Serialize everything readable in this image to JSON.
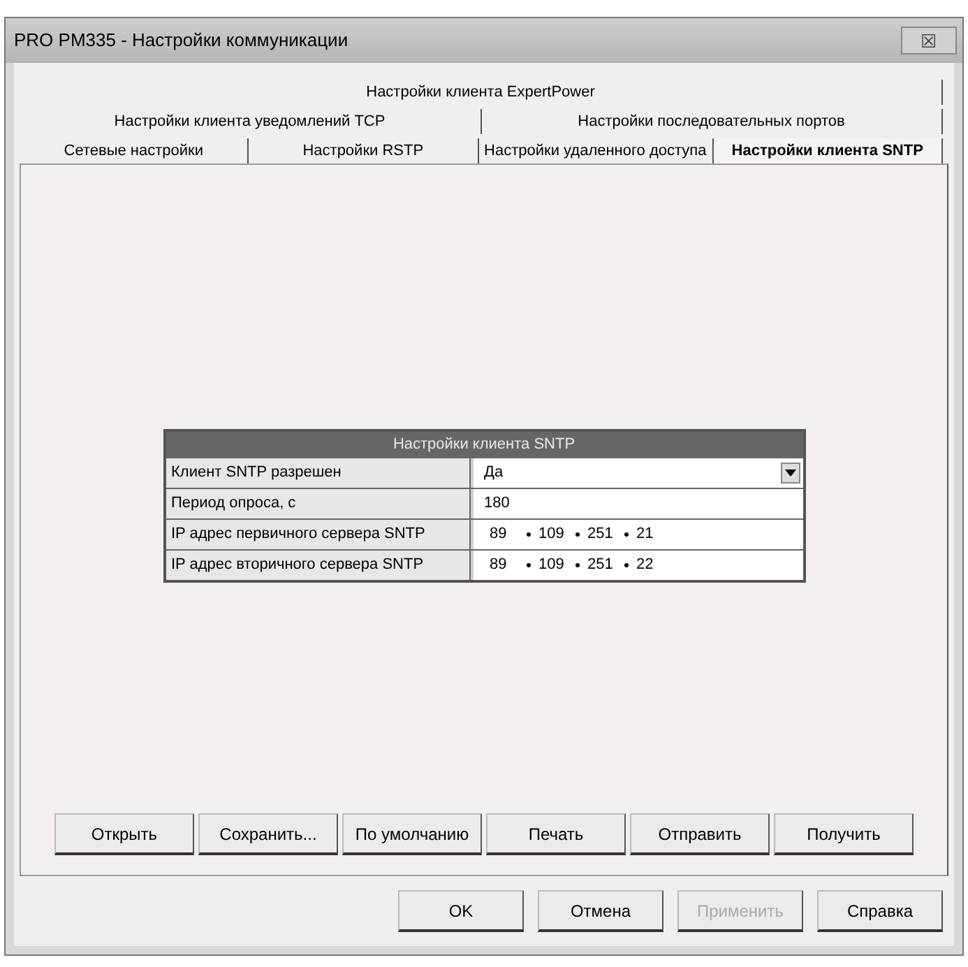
{
  "window": {
    "title": "PRO PM335 - Настройки коммуникации",
    "close": "☒"
  },
  "tab_rows": [
    [
      {
        "label": "Настройки клиента ExpertPower",
        "selected": false
      }
    ],
    [
      {
        "label": "Настройки клиента уведомлений TCP",
        "selected": false
      },
      {
        "label": "Настройки последовательных портов",
        "selected": false
      }
    ],
    [
      {
        "label": "Сетевые настройки",
        "selected": false
      },
      {
        "label": "Настройки RSTP",
        "selected": false
      },
      {
        "label": "Настройки удаленного доступа",
        "selected": false
      },
      {
        "label": "Настройки клиента SNTP",
        "selected": true
      }
    ]
  ],
  "settings_table": {
    "title": "Настройки клиента SNTP",
    "rows": [
      {
        "kind": "dropdown",
        "label": "Клиент SNTP разрешен",
        "value": "Да"
      },
      {
        "kind": "text",
        "label": "Период опроса, с",
        "value": "180"
      },
      {
        "kind": "ip",
        "label": "IP адрес первичного сервера SNTP",
        "octets": [
          "89",
          "109",
          "251",
          "21"
        ]
      },
      {
        "kind": "ip",
        "label": "IP адрес вторичного сервера SNTP",
        "octets": [
          "89",
          "109",
          "251",
          "22"
        ]
      }
    ]
  },
  "panel_buttons": [
    {
      "label": "Открыть"
    },
    {
      "label": "Сохранить..."
    },
    {
      "label": "По умолчанию"
    },
    {
      "label": "Печать"
    },
    {
      "label": "Отправить"
    },
    {
      "label": "Получить"
    }
  ],
  "dialog_buttons": [
    {
      "label": "OK",
      "disabled": false
    },
    {
      "label": "Отмена",
      "disabled": false
    },
    {
      "label": "Применить",
      "disabled": true
    },
    {
      "label": "Справка",
      "disabled": false
    }
  ]
}
